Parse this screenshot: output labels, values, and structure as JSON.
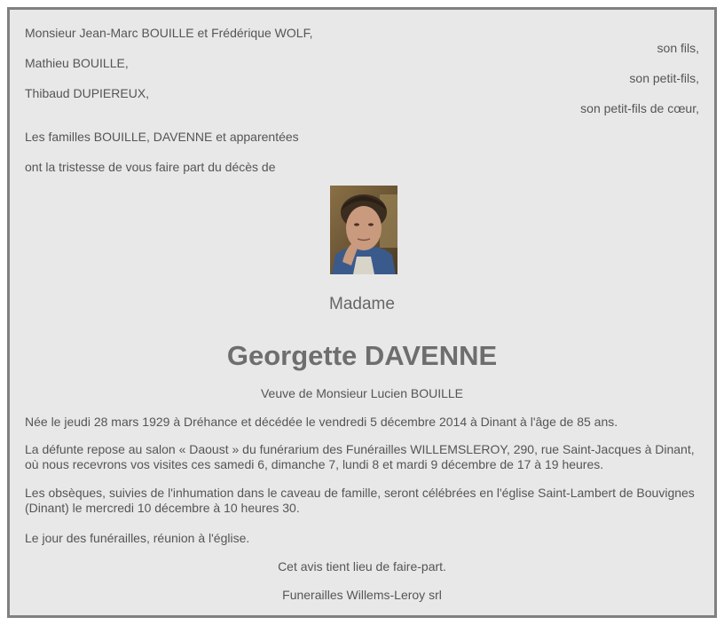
{
  "family": {
    "line1": "Monsieur Jean-Marc BOUILLE et Frédérique WOLF,",
    "role1": "son fils,",
    "line2": "Mathieu BOUILLE,",
    "role2": "son petit-fils,",
    "line3": "Thibaud DUPIEREUX,",
    "role3": "son petit-fils de cœur,",
    "families": "Les familles BOUILLE, DAVENNE et apparentées",
    "intro": "ont la tristesse de vous faire part du décès de"
  },
  "deceased": {
    "title": "Madame",
    "name": "Georgette DAVENNE",
    "widow": "Veuve de Monsieur Lucien BOUILLE"
  },
  "details": {
    "birth_death": "Née le jeudi 28 mars 1929 à Dréhance et décédée le vendredi 5 décembre 2014 à Dinant à l'âge de 85 ans.",
    "rest": "La défunte repose au salon « Daoust » du funérarium des Funérailles WILLEMSLEROY, 290, rue Saint-Jacques à Dinant, où nous recevrons vos visites ces samedi 6, dimanche 7, lundi 8 et mardi 9 décembre de 17 à 19 heures.",
    "funeral": "Les obsèques, suivies de l'inhumation dans le caveau de famille, seront célébrées en l'église Saint-Lambert de Bouvignes (Dinant) le mercredi 10 décembre à 10 heures 30.",
    "gathering": "Le jour des funérailles, réunion à l'église.",
    "notice": "Cet avis tient lieu de faire-part.",
    "company": "Funerailles Willems-Leroy srl"
  }
}
